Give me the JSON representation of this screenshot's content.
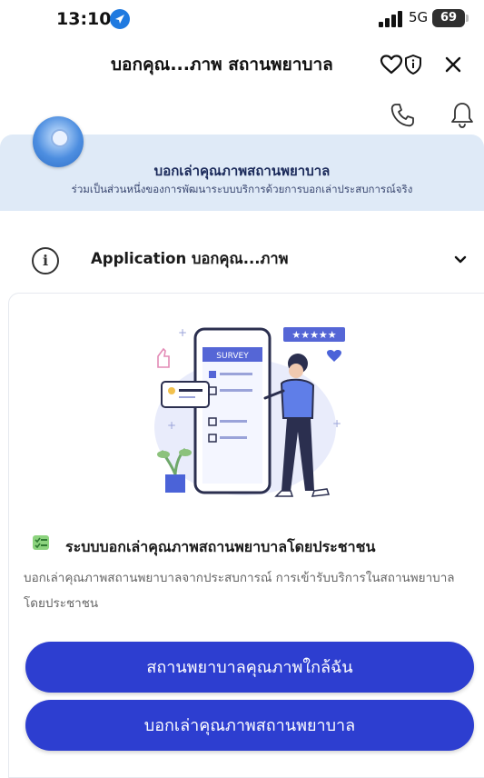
{
  "status_bar": {
    "time": "13:10",
    "network": "5G",
    "battery": "69"
  },
  "topnav": {
    "title": "บอกคุณ...ภาพ สถานพยาบาล"
  },
  "banner": {
    "title": "บอกเล่าคุณภาพสถานพยาบาล",
    "subtitle": "ร่วมเป็นส่วนหนึ่งของการพัฒนาระบบบริการด้วยการบอกเล่าประสบการณ์จริง"
  },
  "info_row": {
    "label": "Application บอกคุณ...ภาพ"
  },
  "card": {
    "illustration_text": "SURVEY",
    "feature_title": "ระบบบอกเล่าคุณภาพสถานพยาบาลโดยประชาชน",
    "feature_desc": "บอกเล่าคุณภาพสถานพยาบาลจากประสบการณ์ การเข้ารับบริการในสถานพยาบาล โดยประชาชน",
    "btn_nearby": "สถานพยาบาลคุณภาพใกล้ฉัน",
    "btn_report": "บอกเล่าคุณภาพสถานพยาบาล"
  },
  "colors": {
    "primary": "#2d3ed0",
    "banner_bg": "#dfeaf7",
    "location_badge": "#1f7ae0"
  },
  "icons": [
    "location-arrow-icon",
    "signal-icon",
    "heart-icon",
    "shield-icon",
    "close-icon",
    "phone-icon",
    "bell-icon",
    "info-icon",
    "chevron-down-icon",
    "checklist-icon"
  ]
}
